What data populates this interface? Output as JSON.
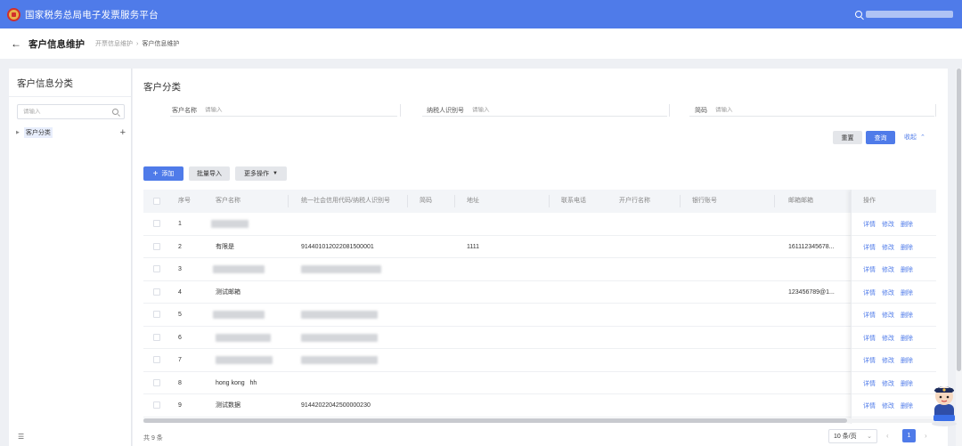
{
  "header": {
    "app_title": "国家税务总局电子发票服务平台"
  },
  "titlebar": {
    "back_icon": "arrow-left-icon",
    "page_title": "客户信息维护",
    "breadcrumb": [
      "开票信息维护",
      "客户信息维护"
    ]
  },
  "sidebar": {
    "title": "客户信息分类",
    "search_placeholder": "请输入",
    "tree": [
      {
        "label": "客户分类",
        "expanded": false
      }
    ],
    "add_icon": "plus-icon",
    "bottom_icon": "menu-fold-icon"
  },
  "main": {
    "title": "客户分类",
    "filters": [
      {
        "label": "客户名称",
        "placeholder": "请输入"
      },
      {
        "label": "纳税人识别号",
        "placeholder": "请输入"
      },
      {
        "label": "简码",
        "placeholder": "请输入"
      }
    ],
    "buttons": {
      "reset": "重置",
      "query": "查询",
      "collapse": "收起",
      "add": "添加",
      "import": "批量导入",
      "more": "更多操作"
    },
    "table": {
      "columns": [
        "序号",
        "客户名称",
        "统一社会信用代码/纳税人识别号",
        "简码",
        "地址",
        "联系电话",
        "开户行名称",
        "银行账号",
        "邮箱邮箱"
      ],
      "action_header": "操作",
      "action_labels": {
        "detail": "详情",
        "edit": "修改",
        "delete": "删除"
      },
      "rows": [
        {
          "no": "1",
          "name": "",
          "code": "",
          "addr": "",
          "email": ""
        },
        {
          "no": "2",
          "name": "有限是",
          "code": "914401012022081500001",
          "addr": "1111",
          "email": "161112345678..."
        },
        {
          "no": "3",
          "name": "",
          "code": "",
          "addr": "",
          "email": ""
        },
        {
          "no": "4",
          "name": "测试邮箱",
          "code": "",
          "addr": "",
          "email": "123456789@1..."
        },
        {
          "no": "5",
          "name": "",
          "code": "",
          "addr": "",
          "email": ""
        },
        {
          "no": "6",
          "name": "",
          "code": "",
          "addr": "",
          "email": ""
        },
        {
          "no": "7",
          "name": "",
          "code": "",
          "addr": "",
          "email": ""
        },
        {
          "no": "8",
          "name": "hong kong   hh",
          "code": "",
          "addr": "",
          "email": ""
        },
        {
          "no": "9",
          "name": "测试数据",
          "code": "91442022042500000230",
          "addr": "",
          "email": ""
        }
      ]
    },
    "footer": {
      "total": "共 9 条",
      "page_size": "10 条/页",
      "current_page": "1"
    }
  },
  "colors": {
    "primary": "#4f7be9",
    "header_bg": "#4f7be9"
  }
}
